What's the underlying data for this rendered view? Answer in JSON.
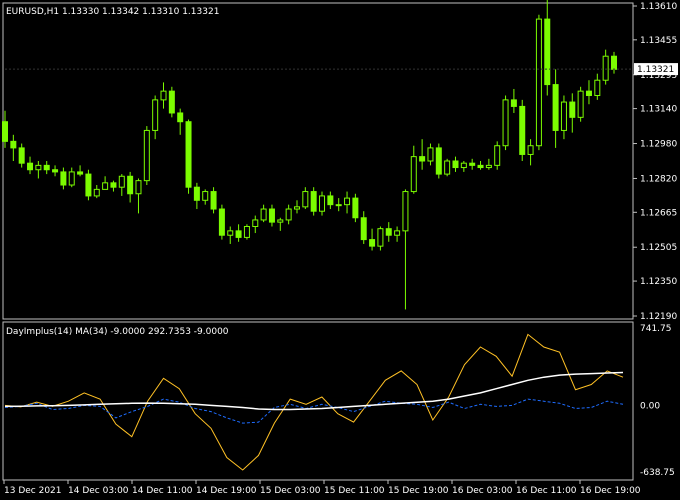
{
  "header": {
    "symbol_label": "EURUSD,H1  1.13330 1.13342 1.13310 1.13321",
    "indicator_label": "DayImplus(14) MA(34) -9.0000 292.7353 -9.0000"
  },
  "colors": {
    "background": "#000000",
    "frame": "#c0c0c0",
    "candle": "#7cfc00",
    "price_line": "#ffffff",
    "indicator_main": "#ffc125",
    "indicator_signal": "#1e6cff",
    "indicator_ma": "#ffffff"
  },
  "chart_data": [
    {
      "type": "candlestick",
      "title": "EURUSD,H1",
      "price_axis_ticks": [
        "1.13610",
        "1.13455",
        "1.13295",
        "1.13140",
        "1.12980",
        "1.12820",
        "1.12665",
        "1.12505",
        "1.12350",
        "1.12190"
      ],
      "ylim": [
        1.1219,
        1.1361
      ],
      "current_price": "1.13321",
      "candles": [
        [
          1.1308,
          1.1313,
          1.1296,
          1.1299
        ],
        [
          1.1299,
          1.1302,
          1.129,
          1.1296
        ],
        [
          1.1296,
          1.1298,
          1.1287,
          1.1289
        ],
        [
          1.1289,
          1.1292,
          1.1284,
          1.1286
        ],
        [
          1.1286,
          1.129,
          1.1282,
          1.1288
        ],
        [
          1.1288,
          1.129,
          1.1284,
          1.1286
        ],
        [
          1.1286,
          1.1288,
          1.1283,
          1.1285
        ],
        [
          1.1285,
          1.1287,
          1.1277,
          1.1279
        ],
        [
          1.1279,
          1.1287,
          1.1278,
          1.1285
        ],
        [
          1.1285,
          1.1288,
          1.1283,
          1.1284
        ],
        [
          1.1284,
          1.1286,
          1.1272,
          1.1274
        ],
        [
          1.1274,
          1.1279,
          1.1273,
          1.1277
        ],
        [
          1.1277,
          1.1283,
          1.1277,
          1.128
        ],
        [
          1.128,
          1.1281,
          1.1276,
          1.1278
        ],
        [
          1.1278,
          1.1284,
          1.1274,
          1.1283
        ],
        [
          1.1283,
          1.1285,
          1.1271,
          1.1275
        ],
        [
          1.1275,
          1.1282,
          1.1266,
          1.1281
        ],
        [
          1.1281,
          1.1306,
          1.1279,
          1.1304
        ],
        [
          1.1304,
          1.132,
          1.13,
          1.1318
        ],
        [
          1.1318,
          1.1326,
          1.1314,
          1.1322
        ],
        [
          1.1322,
          1.1324,
          1.131,
          1.1312
        ],
        [
          1.1312,
          1.1314,
          1.1302,
          1.1308
        ],
        [
          1.1308,
          1.1309,
          1.1275,
          1.1278
        ],
        [
          1.1278,
          1.128,
          1.1268,
          1.1272
        ],
        [
          1.1272,
          1.1277,
          1.127,
          1.1276
        ],
        [
          1.1276,
          1.1278,
          1.1266,
          1.1268
        ],
        [
          1.1268,
          1.127,
          1.1254,
          1.1256
        ],
        [
          1.1256,
          1.126,
          1.1252,
          1.1258
        ],
        [
          1.1258,
          1.1261,
          1.1253,
          1.1255
        ],
        [
          1.1255,
          1.1261,
          1.1254,
          1.126
        ],
        [
          1.126,
          1.1265,
          1.1257,
          1.1263
        ],
        [
          1.1263,
          1.127,
          1.1262,
          1.1268
        ],
        [
          1.1268,
          1.127,
          1.126,
          1.1262
        ],
        [
          1.1262,
          1.1264,
          1.1258,
          1.1263
        ],
        [
          1.1263,
          1.127,
          1.1261,
          1.1268
        ],
        [
          1.1268,
          1.1272,
          1.1266,
          1.1269
        ],
        [
          1.1269,
          1.1278,
          1.1268,
          1.1276
        ],
        [
          1.1276,
          1.1278,
          1.1265,
          1.1267
        ],
        [
          1.1267,
          1.1276,
          1.1265,
          1.1274
        ],
        [
          1.1274,
          1.1276,
          1.1268,
          1.127
        ],
        [
          1.127,
          1.1273,
          1.1267,
          1.127
        ],
        [
          1.127,
          1.1276,
          1.1266,
          1.1273
        ],
        [
          1.1273,
          1.1275,
          1.1262,
          1.1264
        ],
        [
          1.1264,
          1.1267,
          1.1252,
          1.1254
        ],
        [
          1.1254,
          1.1259,
          1.1249,
          1.1251
        ],
        [
          1.1251,
          1.126,
          1.1249,
          1.1259
        ],
        [
          1.1259,
          1.1262,
          1.1253,
          1.1256
        ],
        [
          1.1256,
          1.126,
          1.1253,
          1.1258
        ],
        [
          1.1258,
          1.1277,
          1.1222,
          1.1276
        ],
        [
          1.1276,
          1.1297,
          1.1275,
          1.1292
        ],
        [
          1.1292,
          1.13,
          1.1286,
          1.129
        ],
        [
          1.129,
          1.1298,
          1.1288,
          1.1296
        ],
        [
          1.1296,
          1.1298,
          1.1282,
          1.1284
        ],
        [
          1.1284,
          1.1291,
          1.1283,
          1.129
        ],
        [
          1.129,
          1.1292,
          1.1285,
          1.1287
        ],
        [
          1.1287,
          1.129,
          1.1285,
          1.1289
        ],
        [
          1.1289,
          1.1291,
          1.1286,
          1.1288
        ],
        [
          1.1288,
          1.129,
          1.1286,
          1.1287
        ],
        [
          1.1287,
          1.1291,
          1.1286,
          1.1288
        ],
        [
          1.1288,
          1.1299,
          1.1286,
          1.1297
        ],
        [
          1.1297,
          1.132,
          1.1295,
          1.1318
        ],
        [
          1.1318,
          1.1323,
          1.1312,
          1.1315
        ],
        [
          1.1315,
          1.1318,
          1.129,
          1.1293
        ],
        [
          1.1293,
          1.13,
          1.1288,
          1.1297
        ],
        [
          1.1297,
          1.1357,
          1.1295,
          1.1355
        ],
        [
          1.1355,
          1.1365,
          1.132,
          1.1325
        ],
        [
          1.1325,
          1.1332,
          1.1296,
          1.1304
        ],
        [
          1.1304,
          1.132,
          1.13,
          1.1317
        ],
        [
          1.1317,
          1.1321,
          1.1303,
          1.131
        ],
        [
          1.131,
          1.1324,
          1.1308,
          1.1322
        ],
        [
          1.1322,
          1.1327,
          1.1316,
          1.132
        ],
        [
          1.132,
          1.133,
          1.1318,
          1.1327
        ],
        [
          1.1327,
          1.1341,
          1.1325,
          1.1338
        ],
        [
          1.1338,
          1.134,
          1.133,
          1.1332
        ]
      ]
    },
    {
      "type": "line",
      "title": "DayImplus(14) MA(34)",
      "yaxis_ticks": [
        "741.75",
        "0.00",
        "-638.75"
      ],
      "ylim": [
        -638.75,
        741.75
      ],
      "series": [
        {
          "values": [
            0,
            -15,
            30,
            -10,
            40,
            120,
            60,
            -180,
            -300,
            40,
            260,
            160,
            -80,
            -220,
            -500,
            -620,
            -480,
            -170,
            60,
            10,
            80,
            -80,
            -160,
            40,
            240,
            330,
            200,
            -140,
            80,
            390,
            560,
            470,
            280,
            680,
            560,
            510,
            150,
            200,
            330,
            270
          ]
        },
        {
          "values": [
            -20,
            -10,
            20,
            -40,
            -30,
            0,
            -10,
            -120,
            -60,
            -10,
            60,
            30,
            -30,
            -60,
            -120,
            -170,
            -160,
            -20,
            10,
            -30,
            10,
            -20,
            -60,
            -10,
            40,
            20,
            10,
            -20,
            30,
            -30,
            10,
            -10,
            0,
            60,
            40,
            20,
            -30,
            -20,
            40,
            10
          ]
        },
        {
          "values": [
            -10,
            -8,
            -5,
            -3,
            0,
            5,
            10,
            15,
            20,
            22,
            20,
            15,
            10,
            0,
            -10,
            -20,
            -35,
            -40,
            -40,
            -35,
            -30,
            -20,
            -10,
            0,
            10,
            20,
            30,
            40,
            60,
            90,
            120,
            160,
            200,
            240,
            270,
            290,
            300,
            305,
            310,
            315
          ]
        }
      ]
    }
  ],
  "time_axis": {
    "labels": [
      "13 Dec 2021",
      "14 Dec 03:00",
      "14 Dec 11:00",
      "14 Dec 19:00",
      "15 Dec 03:00",
      "15 Dec 11:00",
      "15 Dec 19:00",
      "16 Dec 03:00",
      "16 Dec 11:00",
      "16 Dec 19:00"
    ]
  }
}
